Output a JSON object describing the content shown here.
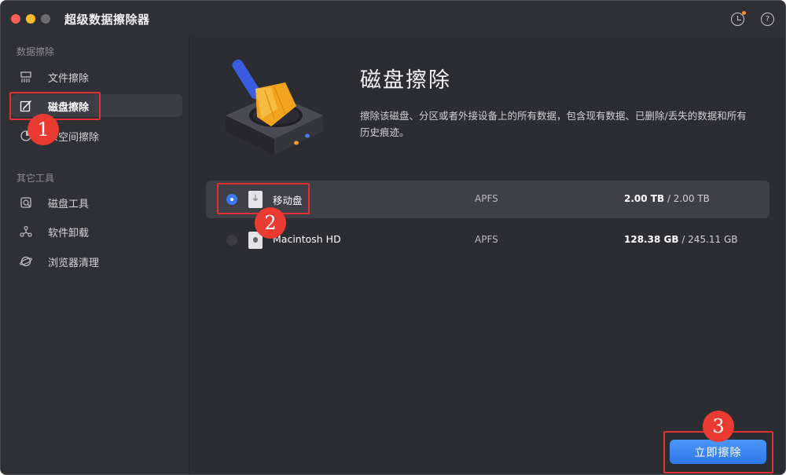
{
  "window": {
    "title": "超级数据擦除器"
  },
  "toolbar": {
    "history_icon": "history-clock-icon",
    "help_icon": "help-icon",
    "help_glyph": "?"
  },
  "sidebar": {
    "sections": [
      {
        "label": "数据擦除",
        "items": [
          {
            "label": "文件擦除",
            "icon": "file-shredder-icon"
          },
          {
            "label": "磁盘擦除",
            "icon": "disk-erase-icon",
            "active": true
          },
          {
            "label": "剩余空间擦除",
            "display_label": "余空间擦除",
            "icon": "free-space-icon"
          }
        ]
      },
      {
        "label": "其它工具",
        "items": [
          {
            "label": "磁盘工具",
            "icon": "disk-tool-icon"
          },
          {
            "label": "软件卸载",
            "icon": "uninstall-icon"
          },
          {
            "label": "浏览器清理",
            "icon": "browser-clean-icon"
          }
        ]
      }
    ]
  },
  "main": {
    "title": "磁盘擦除",
    "description": "擦除该磁盘、分区或者外接设备上的所有数据，包含现有数据、已删除/丢失的数据和所有历史痕迹。",
    "disks": [
      {
        "name": "移动盘",
        "fs": "APFS",
        "used": "2.00 TB",
        "total": "/ 2.00 TB",
        "selected": true,
        "icon": "usb-drive-icon",
        "icon_glyph": "⏚"
      },
      {
        "name": "Macintosh HD",
        "fs": "APFS",
        "used": "128.38 GB",
        "total": "/ 245.11 GB",
        "selected": false,
        "icon": "internal-drive-icon",
        "icon_glyph": ""
      }
    ],
    "action_button": "立即擦除"
  },
  "annotations": {
    "step1": "1",
    "step2": "2",
    "step3": "3"
  },
  "colors": {
    "accent": "#3a78f2",
    "highlight": "#e0332f",
    "background": "#2c2c33"
  }
}
